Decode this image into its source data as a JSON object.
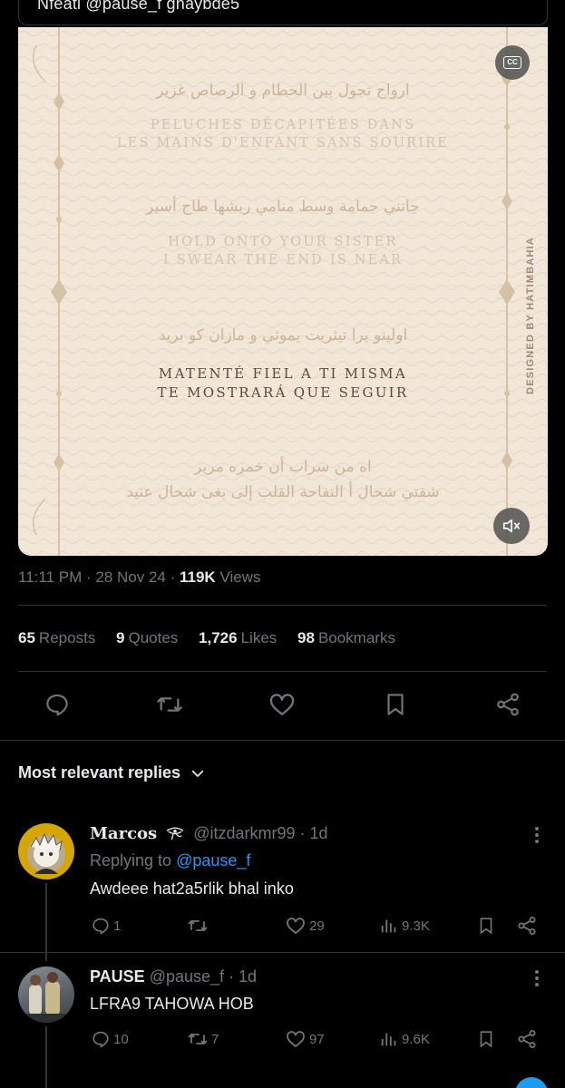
{
  "top_card": {
    "text": "Nfeati @pause_f ghaybde5"
  },
  "media": {
    "arabic_1": "ارواح تجول بين الحطام و الرصاص غزير",
    "french_1a": "PELUCHES DÉCAPITÉES DANS",
    "french_1b": "LES MAINS D'ENFANT SANS SOURIRE",
    "arabic_2": "جاتني حمامة وسط منامي ريشها طاح أسير",
    "english_a": "HOLD ONTO YOUR SISTER",
    "english_b": "I SWEAR THE END IS NEAR",
    "arabic_3": "اولينو يرا تيثريت يموثي و مازان كو بريد",
    "spanish_a": "MATENTÉ FIEL A TI MISMA",
    "spanish_b": "TE MOSTRARÁ QUE SEGUIR",
    "arabic_4": "اه من سراب أن خمره مرير",
    "arabic_5": "شفتي شحال أ التفاحة القلب إلى بغى شحال عنيد",
    "designed_by": "DESIGNED BY HATIMBAHIA",
    "cc_label": "CC"
  },
  "meta": {
    "time": "11:11 PM",
    "date": "28 Nov 24",
    "views_count": "119K",
    "views_label": "Views"
  },
  "stats": {
    "reposts_count": "65",
    "reposts_label": "Reposts",
    "quotes_count": "9",
    "quotes_label": "Quotes",
    "likes_count": "1,726",
    "likes_label": "Likes",
    "bookmarks_count": "98",
    "bookmarks_label": "Bookmarks"
  },
  "icons": [
    "reply-icon",
    "repost-icon",
    "like-icon",
    "bookmark-icon",
    "share-icon"
  ],
  "replies_header": "Most relevant replies",
  "replies": [
    {
      "name": "Marcos",
      "handle": "@itzdarkmr99",
      "time": "· 1d",
      "replying_prefix": "Replying to",
      "replying_to": "@pause_f",
      "text": "Awdeee hat2a5rlik bhal inko",
      "replies": "1",
      "reposts": "",
      "likes": "29",
      "views": "9.3K"
    },
    {
      "name": "PAUSE",
      "handle": "@pause_f",
      "time": "· 1d",
      "text": "LFRA9 TAHOWA HOB",
      "replies": "10",
      "reposts": "7",
      "likes": "97",
      "views": "9.6K"
    }
  ],
  "colors": {
    "background": "#000000",
    "text": "#e7e9ea",
    "muted": "#71767b",
    "link": "#1d9bf0",
    "media_bg": "#f1e6d7"
  }
}
